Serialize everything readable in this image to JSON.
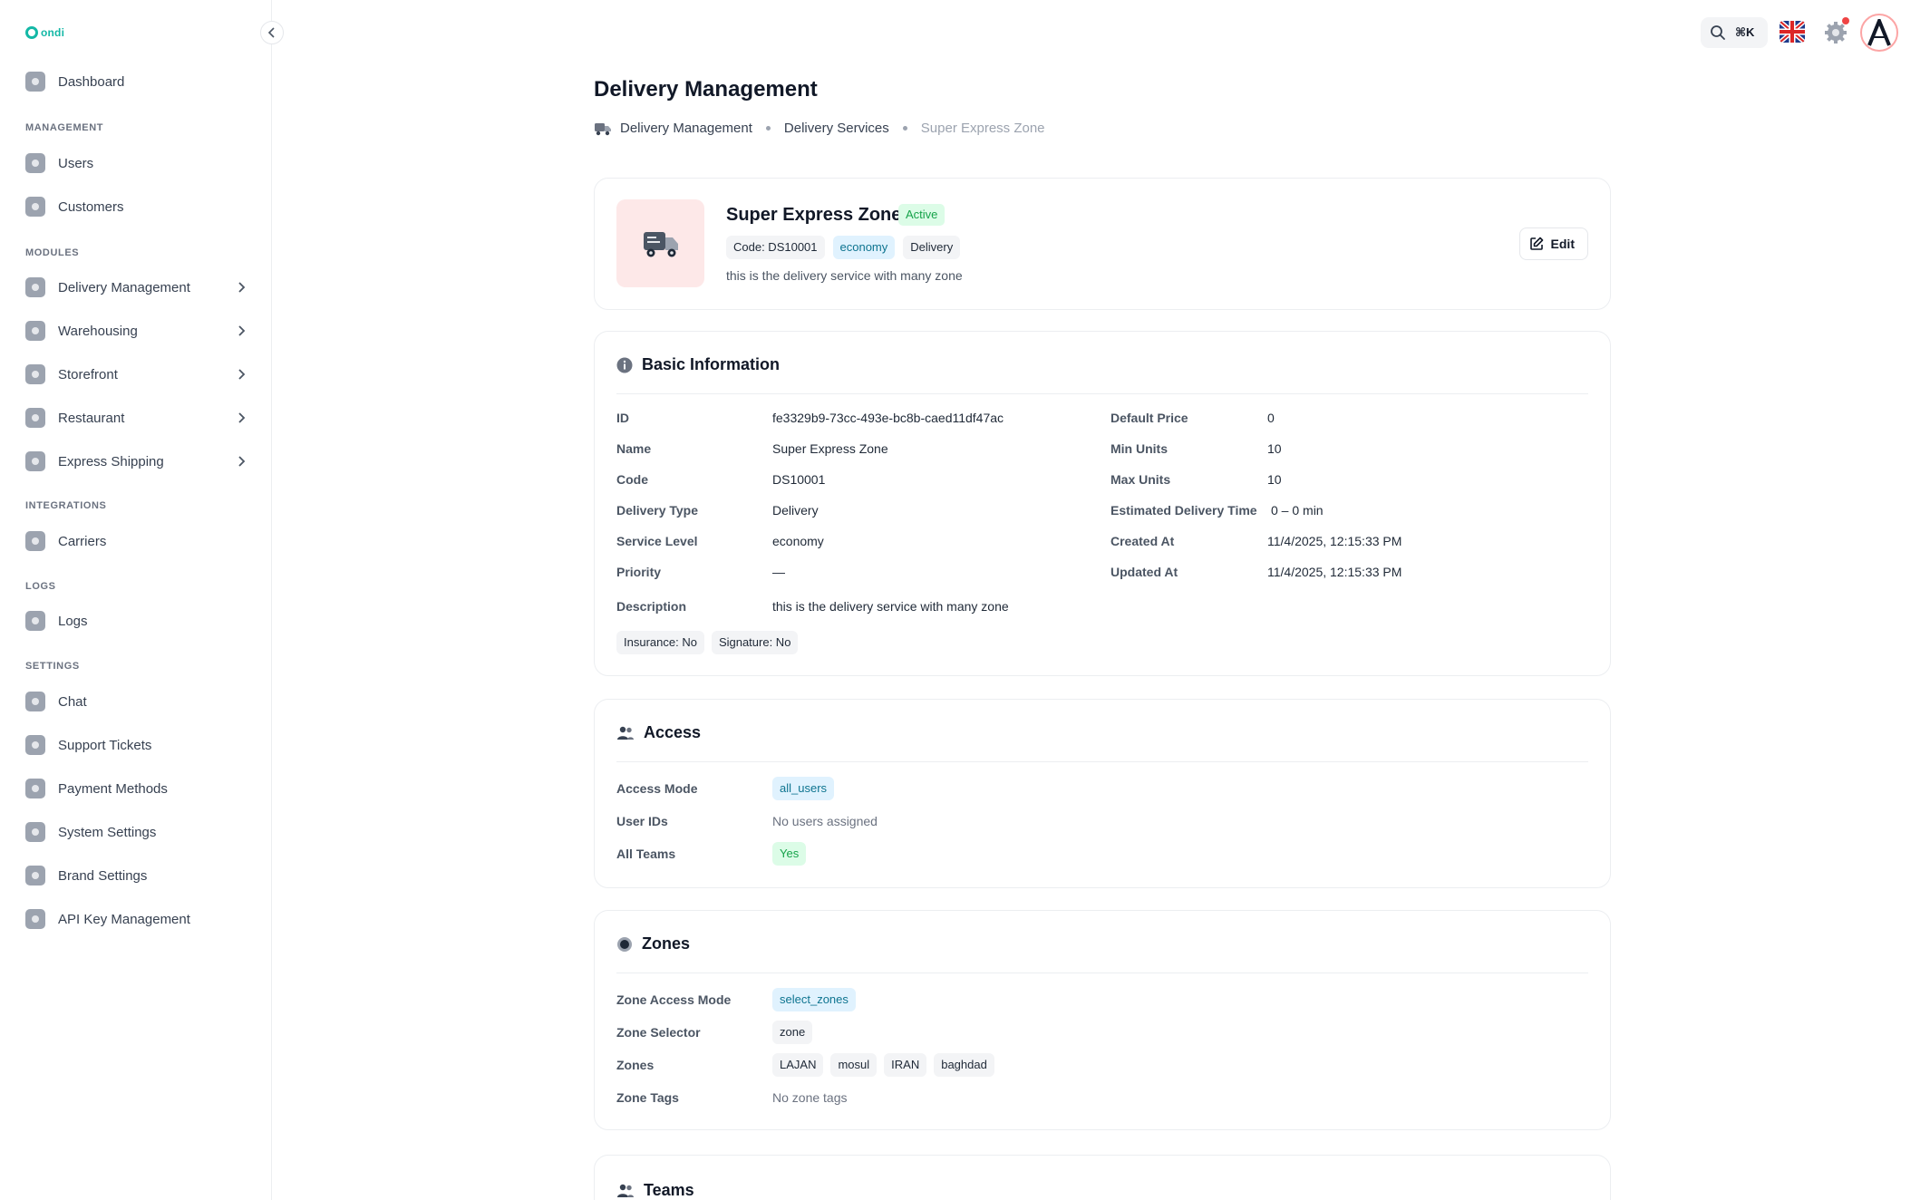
{
  "app": {
    "logo_text": "ondi"
  },
  "sidebar": {
    "dashboard": "Dashboard",
    "section_management": "MANAGEMENT",
    "users": "Users",
    "customers": "Customers",
    "section_modules": "MODULES",
    "delivery_management": "Delivery Management",
    "warehousing": "Warehousing",
    "storefront": "Storefront",
    "restaurant": "Restaurant",
    "express_shipping": "Express Shipping",
    "section_integrations": "INTEGRATIONS",
    "carriers": "Carriers",
    "section_logs": "LOGS",
    "logs": "Logs",
    "section_settings": "SETTINGS",
    "chat": "Chat",
    "support_tickets": "Support Tickets",
    "payment_methods": "Payment Methods",
    "system_settings": "System Settings",
    "brand_settings": "Brand Settings",
    "api_key_management": "API Key Management"
  },
  "topbar": {
    "shortcut": "⌘K"
  },
  "page": {
    "title": "Delivery Management"
  },
  "breadcrumb": {
    "item1": "Delivery Management",
    "item2": "Delivery Services",
    "current": "Super Express Zone"
  },
  "hero": {
    "name": "Super Express Zone",
    "status": "Active",
    "code_chip": "Code: DS10001",
    "level_chip": "economy",
    "type_chip": "Delivery",
    "description": "this is the delivery service with many zone",
    "edit_label": "Edit"
  },
  "basic_info": {
    "title": "Basic Information",
    "labels": {
      "id": "ID",
      "name": "Name",
      "code": "Code",
      "delivery_type": "Delivery Type",
      "service_level": "Service Level",
      "priority": "Priority",
      "default_price": "Default Price",
      "min_units": "Min Units",
      "max_units": "Max Units",
      "estimated_delivery_time": "Estimated Delivery Time",
      "created_at": "Created At",
      "updated_at": "Updated At",
      "description": "Description"
    },
    "values": {
      "id": "fe3329b9-73cc-493e-bc8b-caed11df47ac",
      "name": "Super Express Zone",
      "code": "DS10001",
      "delivery_type": "Delivery",
      "service_level": "economy",
      "priority": "—",
      "default_price": "0",
      "min_units": "10",
      "max_units": "10",
      "estimated_delivery_time": "0 – 0 min",
      "created_at": "11/4/2025, 12:15:33 PM",
      "updated_at": "11/4/2025, 12:15:33 PM",
      "description": "this is the delivery service with many zone"
    },
    "insurance_chip": "Insurance: No",
    "signature_chip": "Signature: No"
  },
  "access": {
    "title": "Access",
    "labels": {
      "access_mode": "Access Mode",
      "user_ids": "User IDs",
      "all_teams": "All Teams"
    },
    "values": {
      "access_mode": "all_users",
      "user_ids": "No users assigned",
      "all_teams": "Yes"
    }
  },
  "zones": {
    "title": "Zones",
    "labels": {
      "zone_access_mode": "Zone Access Mode",
      "zone_selector": "Zone Selector",
      "zones": "Zones",
      "zone_tags": "Zone Tags"
    },
    "values": {
      "zone_access_mode": "select_zones",
      "zone_selector": "zone",
      "zones": [
        "LAJAN",
        "mosul",
        "IRAN",
        "baghdad"
      ],
      "zone_tags": "No zone tags"
    }
  },
  "teams": {
    "title": "Teams"
  },
  "colors": {
    "accent": "#14b8a6",
    "active_green": "#16a34a",
    "chip_blue": "#0e7490",
    "notification": "#ef4444"
  }
}
